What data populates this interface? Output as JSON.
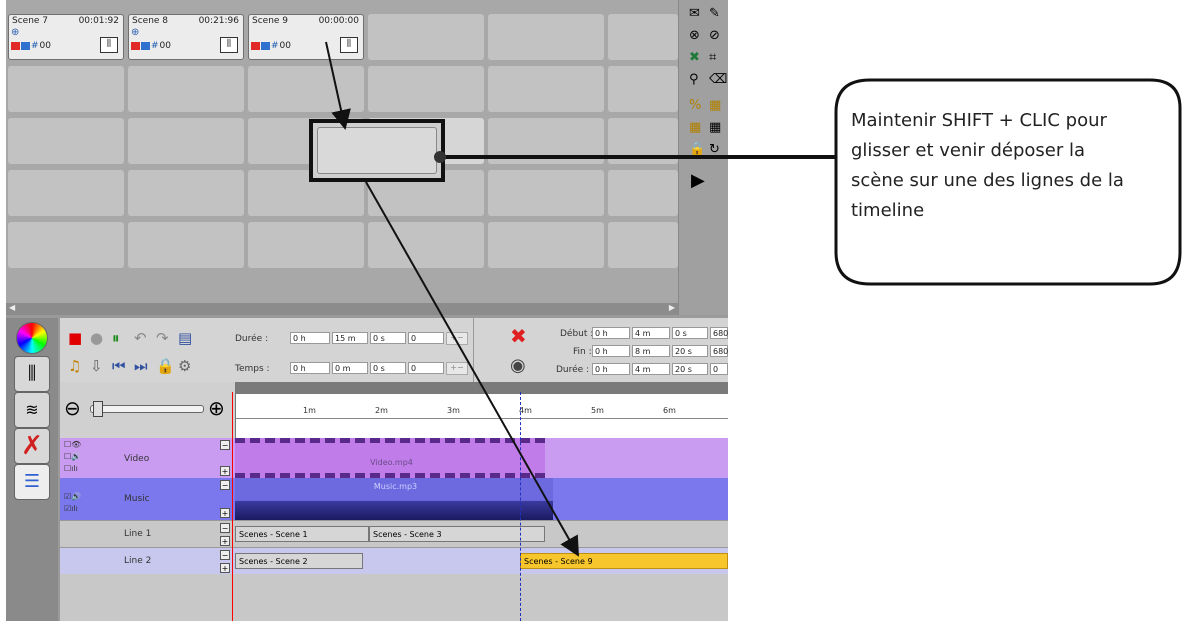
{
  "scenes": [
    {
      "name": "Scene 7",
      "time": "00:01:92",
      "counter": "00"
    },
    {
      "name": "Scene 8",
      "time": "00:21:96",
      "counter": "00"
    },
    {
      "name": "Scene 9",
      "time": "00:00:00",
      "counter": "00"
    }
  ],
  "transport": {
    "duree_label": "Durée :",
    "temps_label": "Temps :",
    "duree_fields": [
      "0 h",
      "15 m",
      "0 s",
      "0"
    ],
    "temps_fields": [
      "0 h",
      "0 m",
      "0 s",
      "0"
    ]
  },
  "range": {
    "debut_label": "Début :",
    "fin_label": "Fin :",
    "duree_label": "Durée :",
    "debut_fields": [
      "0 h",
      "4 m",
      "0 s",
      "680"
    ],
    "fin_fields": [
      "0 h",
      "8 m",
      "20 s",
      "680"
    ],
    "duree_fields": [
      "0 h",
      "4 m",
      "20 s",
      "0"
    ]
  },
  "ruler_ticks": [
    "1m",
    "2m",
    "3m",
    "4m",
    "5m",
    "6m"
  ],
  "tracks": [
    {
      "name": "Video",
      "clips": [
        "Video.mp4"
      ]
    },
    {
      "name": "Music",
      "clips": [
        "Music.mp3"
      ]
    },
    {
      "name": "Line 1",
      "clips": [
        "Scenes - Scene 1",
        "Scenes - Scene 3"
      ]
    },
    {
      "name": "Line 2",
      "clips": [
        "Scenes - Scene 2",
        "Scenes - Scene 9"
      ]
    }
  ],
  "callout": {
    "lines": [
      "Maintenir SHIFT + CLIC pour",
      "glisser et venir déposer la",
      "scène sur une des lignes de la",
      "timeline"
    ]
  },
  "colors": {
    "video_track": "#c99cf2",
    "music_track": "#7b78ee",
    "scene_clip": "#c8c8c8",
    "highlight_clip": "#f7c62c",
    "playhead": "#ff0000"
  }
}
